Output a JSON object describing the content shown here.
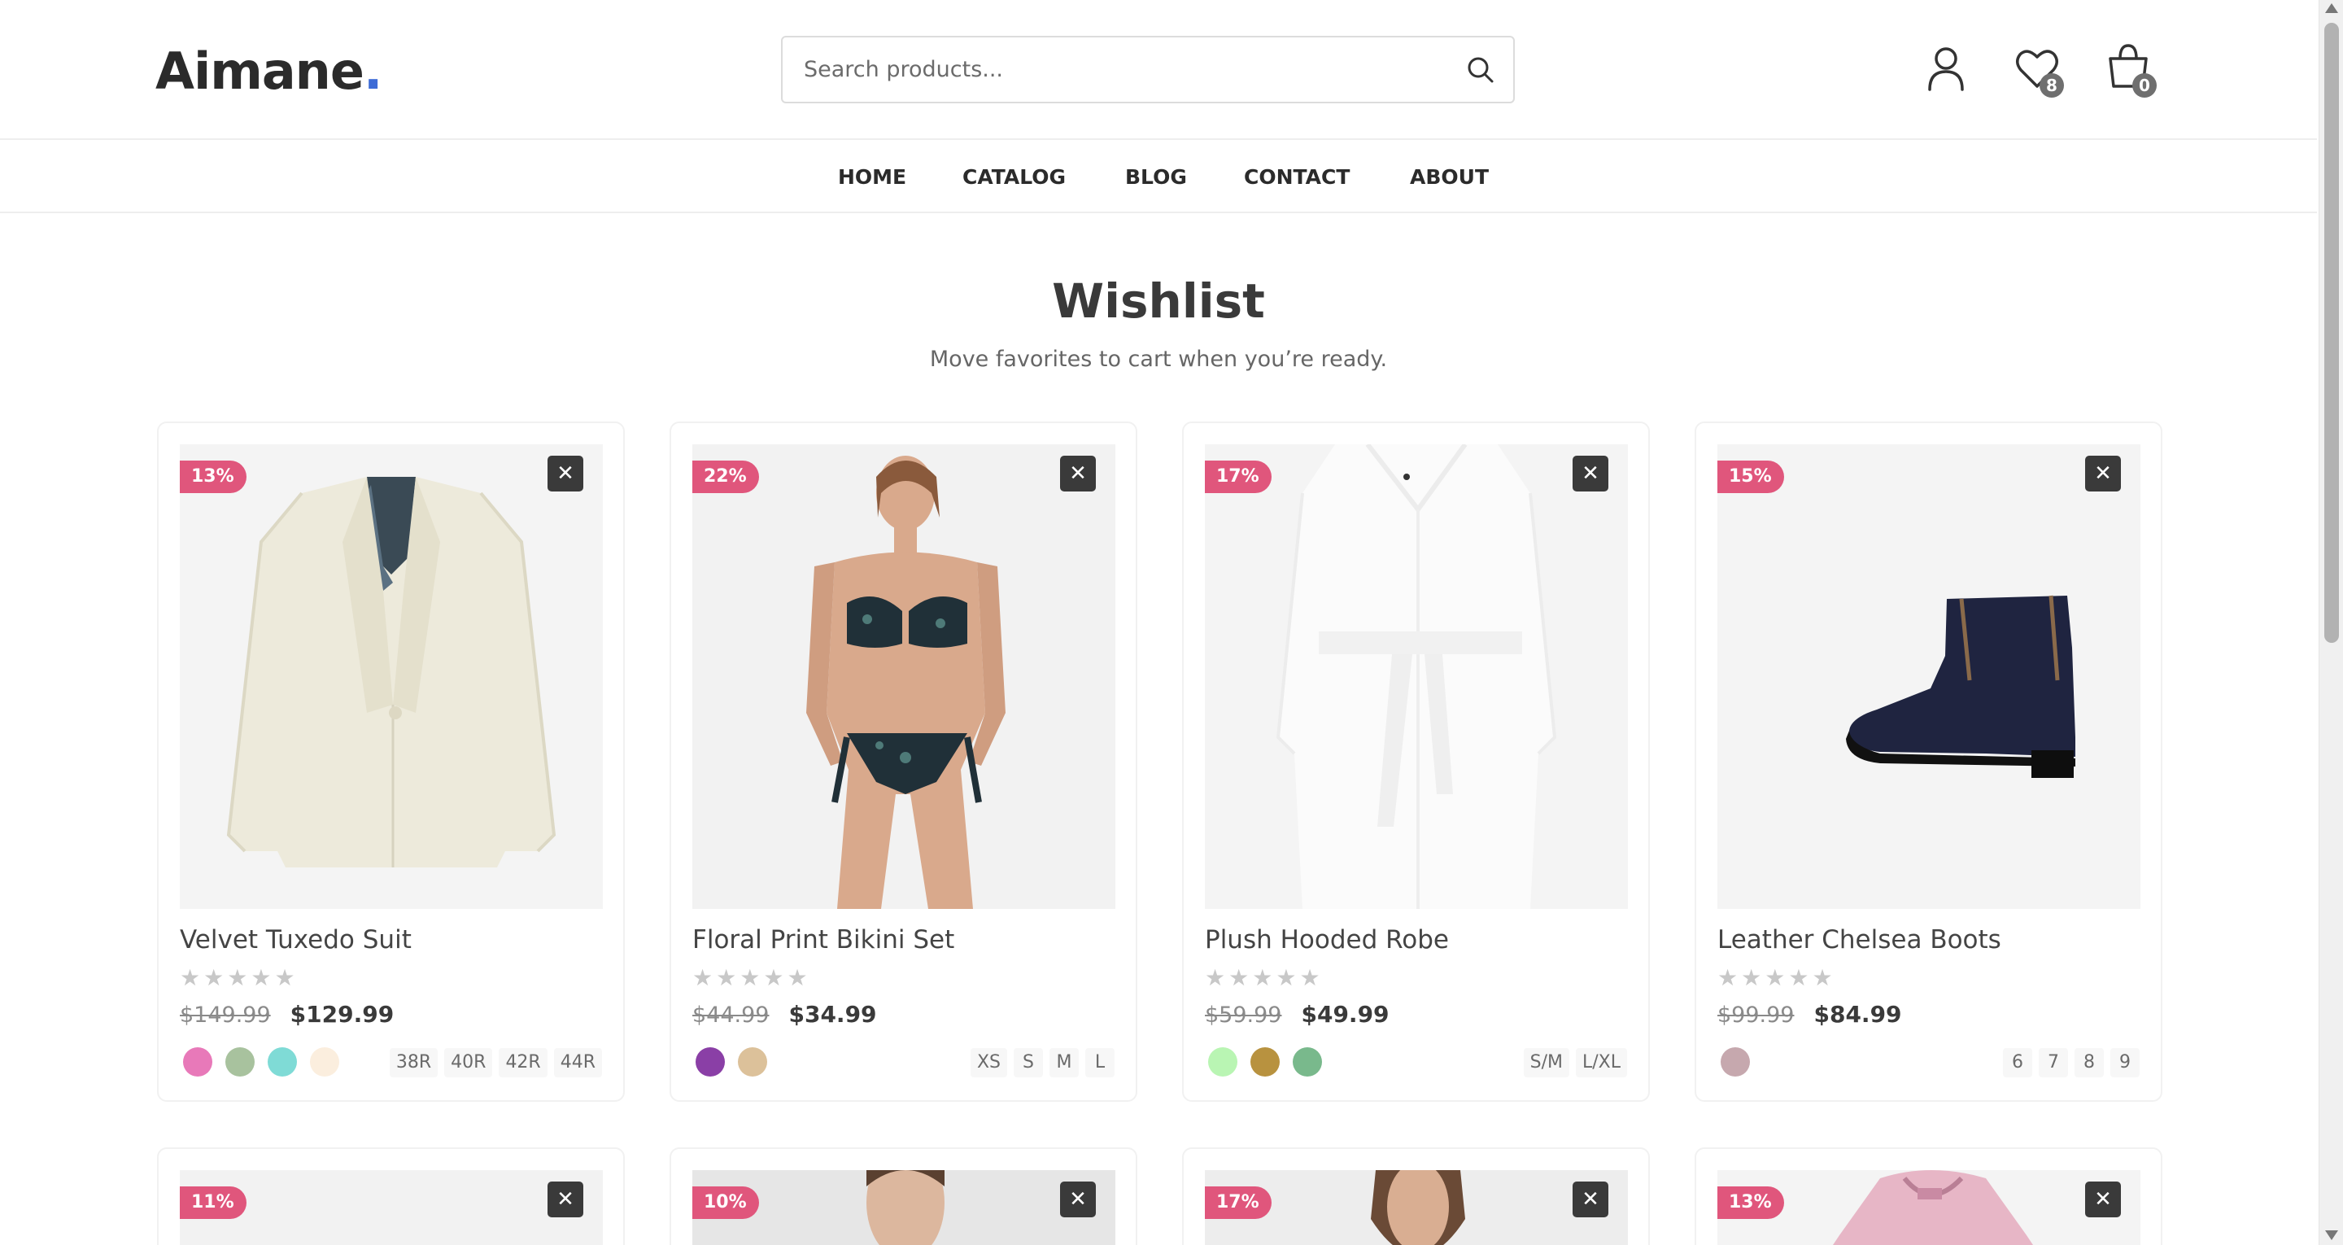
{
  "brand": {
    "name": "Aimane",
    "dot": ".",
    "accent": "#3d6bd6"
  },
  "search": {
    "placeholder": "Search products...",
    "icon": "search-icon"
  },
  "header_icons": {
    "account": "user-icon",
    "wishlist": "heart-icon",
    "wishlist_count": "8",
    "cart": "shopping-bag-icon",
    "cart_count": "0"
  },
  "nav": [
    "HOME",
    "CATALOG",
    "BLOG",
    "CONTACT",
    "ABOUT"
  ],
  "page": {
    "title": "Wishlist",
    "subtitle": "Move favorites to cart when you’re ready."
  },
  "colors": {
    "discount_badge": "#e0567c",
    "remove_button": "#3a3a3a"
  },
  "products": [
    {
      "name": "Velvet Tuxedo Suit",
      "discount": "13%",
      "old_price": "$149.99",
      "price": "$129.99",
      "rating": 0,
      "image": "white-tuxedo-jacket",
      "swatches": [
        "#e879b9",
        "#a8c29e",
        "#7fdbd6",
        "#fbeede"
      ],
      "sizes": [
        "38R",
        "40R",
        "42R",
        "44R"
      ]
    },
    {
      "name": "Floral Print Bikini Set",
      "discount": "22%",
      "old_price": "$44.99",
      "price": "$34.99",
      "rating": 0,
      "image": "model-in-floral-bikini",
      "swatches": [
        "#8a3fa6",
        "#dcc19a"
      ],
      "sizes": [
        "XS",
        "S",
        "M",
        "L"
      ]
    },
    {
      "name": "Plush Hooded Robe",
      "discount": "17%",
      "old_price": "$59.99",
      "price": "$49.99",
      "rating": 0,
      "image": "white-hooded-robe",
      "swatches": [
        "#b9f5b3",
        "#b8923f",
        "#79b98c"
      ],
      "sizes": [
        "S/M",
        "L/XL"
      ]
    },
    {
      "name": "Leather Chelsea Boots",
      "discount": "15%",
      "old_price": "$99.99",
      "price": "$84.99",
      "rating": 0,
      "image": "navy-suede-chelsea-boot",
      "swatches": [
        "#c6a8ae"
      ],
      "sizes": [
        "6",
        "7",
        "8",
        "9"
      ]
    }
  ],
  "products_row2": [
    {
      "discount": "11%",
      "image": "product-image"
    },
    {
      "discount": "10%",
      "image": "male-model"
    },
    {
      "discount": "17%",
      "image": "female-model"
    },
    {
      "discount": "13%",
      "image": "pink-hoodie"
    }
  ],
  "remove_label": "✕",
  "star_glyph": "★"
}
